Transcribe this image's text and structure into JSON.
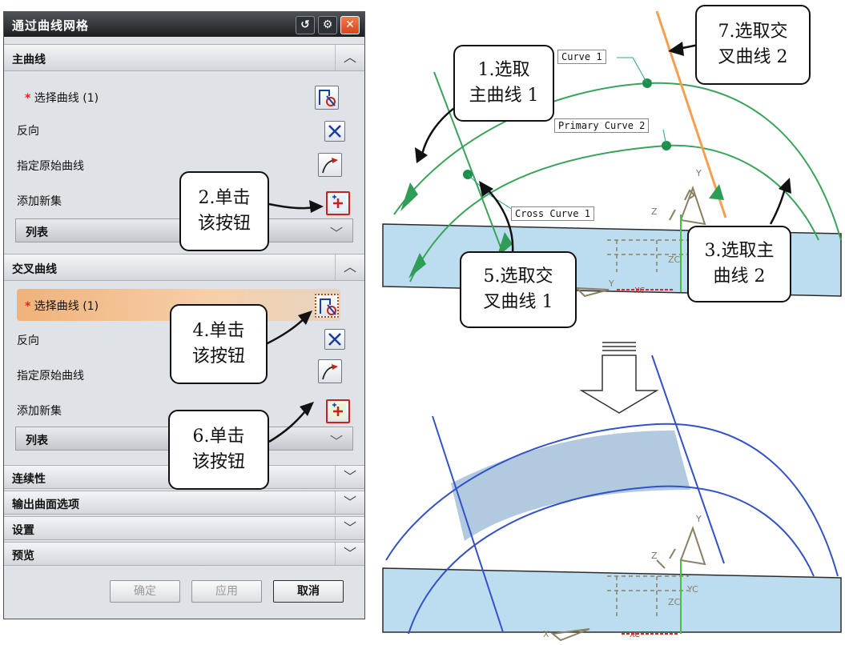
{
  "dialog": {
    "title": "通过曲线网格",
    "titlebar_icons": [
      "reset-icon",
      "gear-icon",
      "close-icon"
    ],
    "primary_section": {
      "header": "主曲线",
      "select_label": "选择曲线 (1)",
      "required_mark": "*",
      "reverse_label": "反向",
      "start_curve_label": "指定原始曲线",
      "add_set_label": "添加新集",
      "list_label": "列表"
    },
    "cross_section": {
      "header": "交叉曲线",
      "select_label": "选择曲线 (1)",
      "required_mark": "*",
      "reverse_label": "反向",
      "start_curve_label": "指定原始曲线",
      "add_set_label": "添加新集",
      "list_label": "列表"
    },
    "collapsed_sections": [
      "连续性",
      "输出曲面选项",
      "设置",
      "预览"
    ],
    "buttons": {
      "ok": "确定",
      "apply": "应用",
      "cancel": "取消"
    }
  },
  "callouts": {
    "c1": [
      "1.选取",
      "主曲线 1"
    ],
    "c2": [
      "2.单击",
      "该按钮"
    ],
    "c3": [
      "3.选取主",
      "曲线 2"
    ],
    "c4": [
      "4.单击",
      "该按钮"
    ],
    "c5": [
      "5.选取交",
      "叉曲线 1"
    ],
    "c6": [
      "6.单击",
      "该按钮"
    ],
    "c7": [
      "7.选取交",
      "叉曲线 2"
    ]
  },
  "viewport_tags": {
    "curve1": "Curve  1",
    "primary2": "Primary Curve  2",
    "cross1": "Cross Curve  1"
  },
  "axis_labels": {
    "y": "Y",
    "z": "Z",
    "zc": "ZC",
    "yc": "YC",
    "x": "X",
    "xc": "XC"
  },
  "colors": {
    "accent_selected": "#f0b27a",
    "curve_green": "#3aa35a",
    "cross_orange": "#f3a04f",
    "plane_blue": "#bcdcf0",
    "result_blue": "#3352c8"
  }
}
